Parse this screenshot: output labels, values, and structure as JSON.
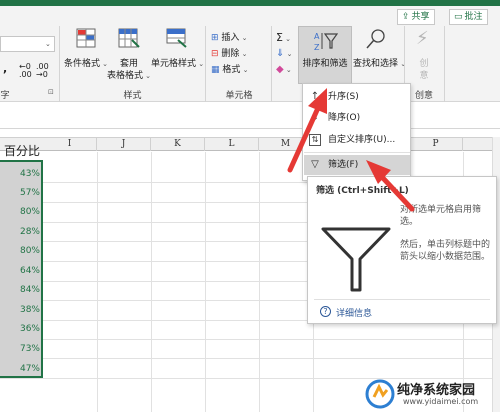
{
  "app": {
    "titlebar_color": "#217346",
    "accent": "#217346"
  },
  "top_buttons": {
    "share_label": "共享",
    "comment_label": "批注"
  },
  "ribbon": {
    "styles_group": {
      "label": "样式",
      "conditional_format": "条件格式",
      "table_format_line1": "套用",
      "table_format_line2": "表格格式",
      "cell_styles": "单元格样式"
    },
    "cells_group": {
      "label": "单元格",
      "insert": "插入",
      "delete": "删除",
      "format": "格式"
    },
    "editing_group": {
      "sort_filter": "排序和筛选",
      "find_select": "查找和选择"
    },
    "create_group": {
      "label": "创意",
      "btn_line1": "创",
      "btn_line2": "意"
    },
    "left_partial_label": "字",
    "number_format_value": ""
  },
  "grid": {
    "columns": [
      "I",
      "J",
      "K",
      "L",
      "M",
      "P"
    ],
    "header_cell": "百分比",
    "values": [
      "43%",
      "57%",
      "80%",
      "28%",
      "80%",
      "64%",
      "84%",
      "38%",
      "36%",
      "73%",
      "47%"
    ]
  },
  "sort_menu": {
    "items": [
      {
        "label": "升序(S)",
        "icon": "sort-ascending-icon",
        "glyph": "↑"
      },
      {
        "label": "降序(O)",
        "icon": "sort-descending-icon",
        "glyph": "↓"
      },
      {
        "label": "自定义排序(U)...",
        "icon": "custom-sort-icon",
        "glyph": "⇅"
      },
      {
        "label": "筛选(F)",
        "icon": "filter-icon",
        "glyph": "▽"
      }
    ],
    "highlight_index": 3
  },
  "tooltip": {
    "title": "筛选 (Ctrl+Shift+L)",
    "line1": "对所选单元格启用筛",
    "line2": "选。",
    "line3": "然后，单击列标题中的",
    "line4": "箭头以缩小数据范围。",
    "link": "详细信息",
    "link_icon": "help-icon"
  },
  "watermark": {
    "title": "纯净系统家园",
    "url": "www.yidaimei.com"
  }
}
